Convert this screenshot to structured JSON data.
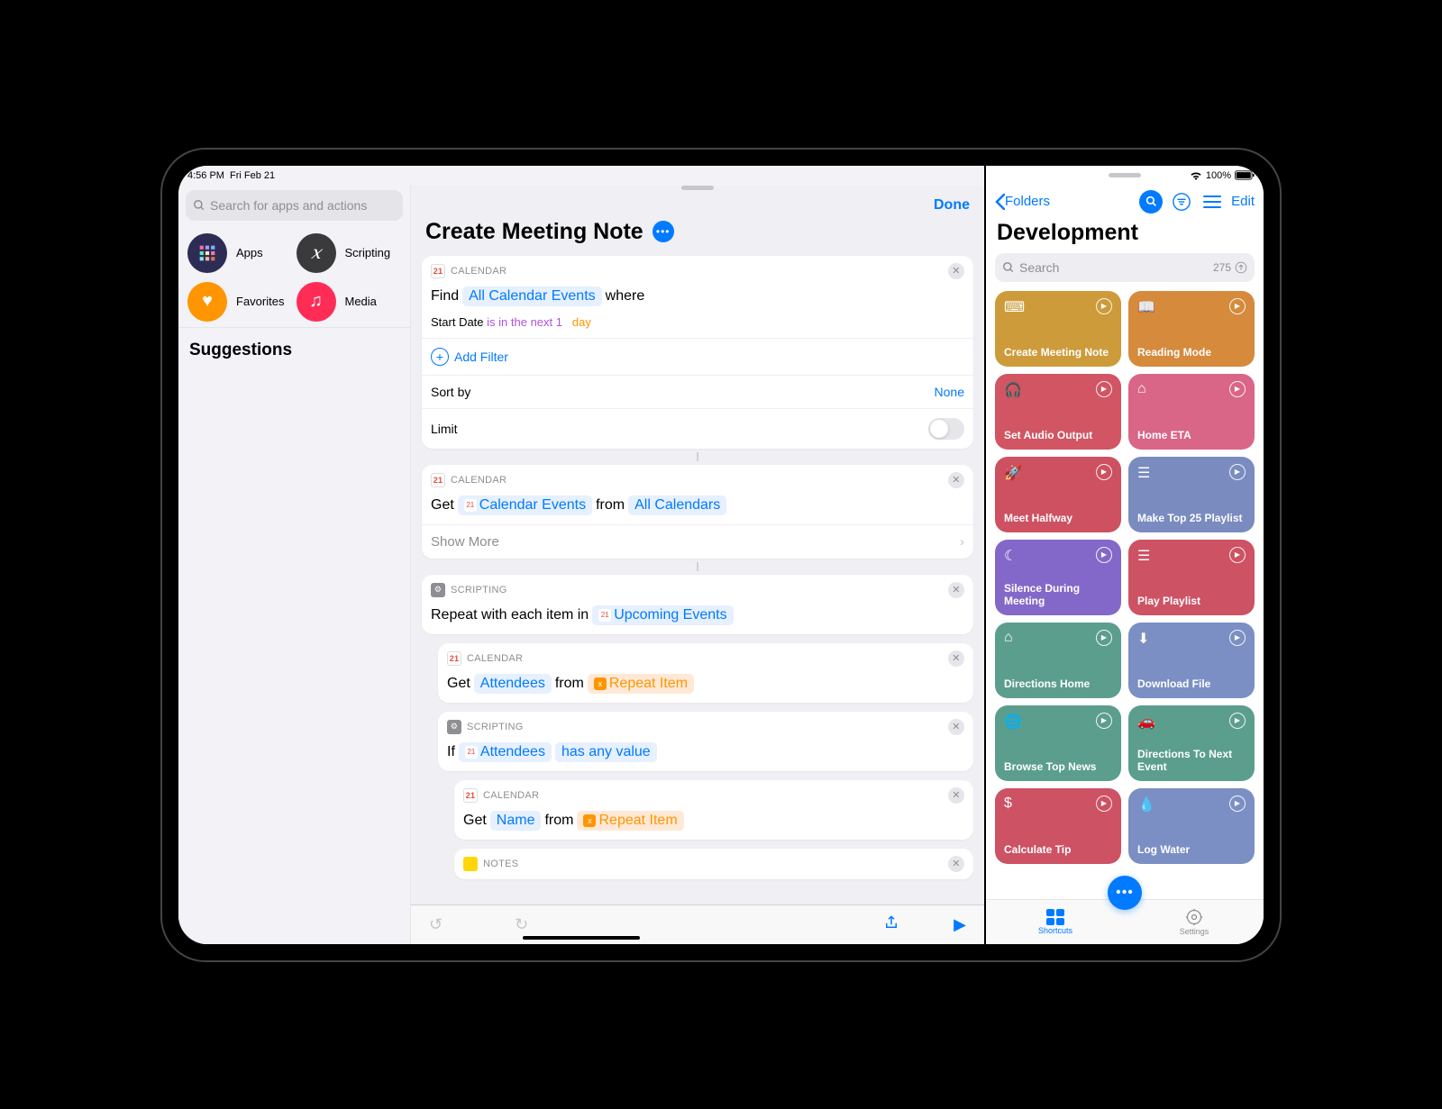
{
  "status": {
    "time": "4:56 PM",
    "date": "Fri Feb 21",
    "wifi": "wifi-icon",
    "battery_pct": "100%"
  },
  "sidebar": {
    "search_placeholder": "Search for apps and actions",
    "cats": [
      {
        "label": "Apps",
        "color": "#2c2c54"
      },
      {
        "label": "Scripting",
        "color": "#3a3a3c"
      },
      {
        "label": "Favorites",
        "color": "#ff9500"
      },
      {
        "label": "Media",
        "color": "#ff2d55"
      }
    ],
    "suggestions_header": "Suggestions"
  },
  "editor": {
    "done": "Done",
    "title": "Create Meeting Note",
    "actions": {
      "a1": {
        "cat": "CALENDAR",
        "verb": "Find",
        "token1": "All Calendar Events",
        "after1": "where",
        "filter_field": "Start Date",
        "filter_op": "is in the next",
        "filter_num": "1",
        "filter_unit": "day",
        "add_filter": "Add Filter",
        "sort_by": "Sort by",
        "sort_val": "None",
        "limit": "Limit"
      },
      "a2": {
        "cat": "CALENDAR",
        "verb": "Get",
        "token1": "Calendar Events",
        "mid": "from",
        "token2": "All Calendars",
        "show_more": "Show More"
      },
      "a3": {
        "cat": "SCRIPTING",
        "text": "Repeat with each item in",
        "token": "Upcoming Events"
      },
      "a4": {
        "cat": "CALENDAR",
        "verb": "Get",
        "token1": "Attendees",
        "mid": "from",
        "token2": "Repeat Item"
      },
      "a5": {
        "cat": "SCRIPTING",
        "verb": "If",
        "token1": "Attendees",
        "token2": "has any value"
      },
      "a6": {
        "cat": "CALENDAR",
        "verb": "Get",
        "token1": "Name",
        "mid": "from",
        "token2": "Repeat Item"
      },
      "a7": {
        "cat": "NOTES"
      }
    }
  },
  "right": {
    "back": "Folders",
    "edit": "Edit",
    "title": "Development",
    "search_placeholder": "Search",
    "count": "275",
    "tiles": [
      {
        "label": "Create Meeting Note",
        "color": "#cd9b3a",
        "icon": "⌨"
      },
      {
        "label": "Reading Mode",
        "color": "#d58a3c",
        "icon": "📖"
      },
      {
        "label": "Set Audio Output",
        "color": "#d15563",
        "icon": "🎧"
      },
      {
        "label": "Home ETA",
        "color": "#d96587",
        "icon": "⌂"
      },
      {
        "label": "Meet Halfway",
        "color": "#cd5160",
        "icon": "🚀"
      },
      {
        "label": "Make Top 25 Playlist",
        "color": "#7a8bc0",
        "icon": "☰"
      },
      {
        "label": "Silence During Meeting",
        "color": "#8468c9",
        "icon": "☾"
      },
      {
        "label": "Play Playlist",
        "color": "#cd5264",
        "icon": "☰"
      },
      {
        "label": "Directions Home",
        "color": "#5c9e8e",
        "icon": "⌂"
      },
      {
        "label": "Download File",
        "color": "#7b8fc4",
        "icon": "⬇"
      },
      {
        "label": "Browse Top News",
        "color": "#5c9e8e",
        "icon": "🌐"
      },
      {
        "label": "Directions To Next Event",
        "color": "#5c9e8e",
        "icon": "🚗"
      },
      {
        "label": "Calculate Tip",
        "color": "#cd5264",
        "icon": "$"
      },
      {
        "label": "Log Water",
        "color": "#7b8fc4",
        "icon": "💧"
      }
    ],
    "tabs": {
      "shortcuts": "Shortcuts",
      "settings": "Settings"
    }
  }
}
